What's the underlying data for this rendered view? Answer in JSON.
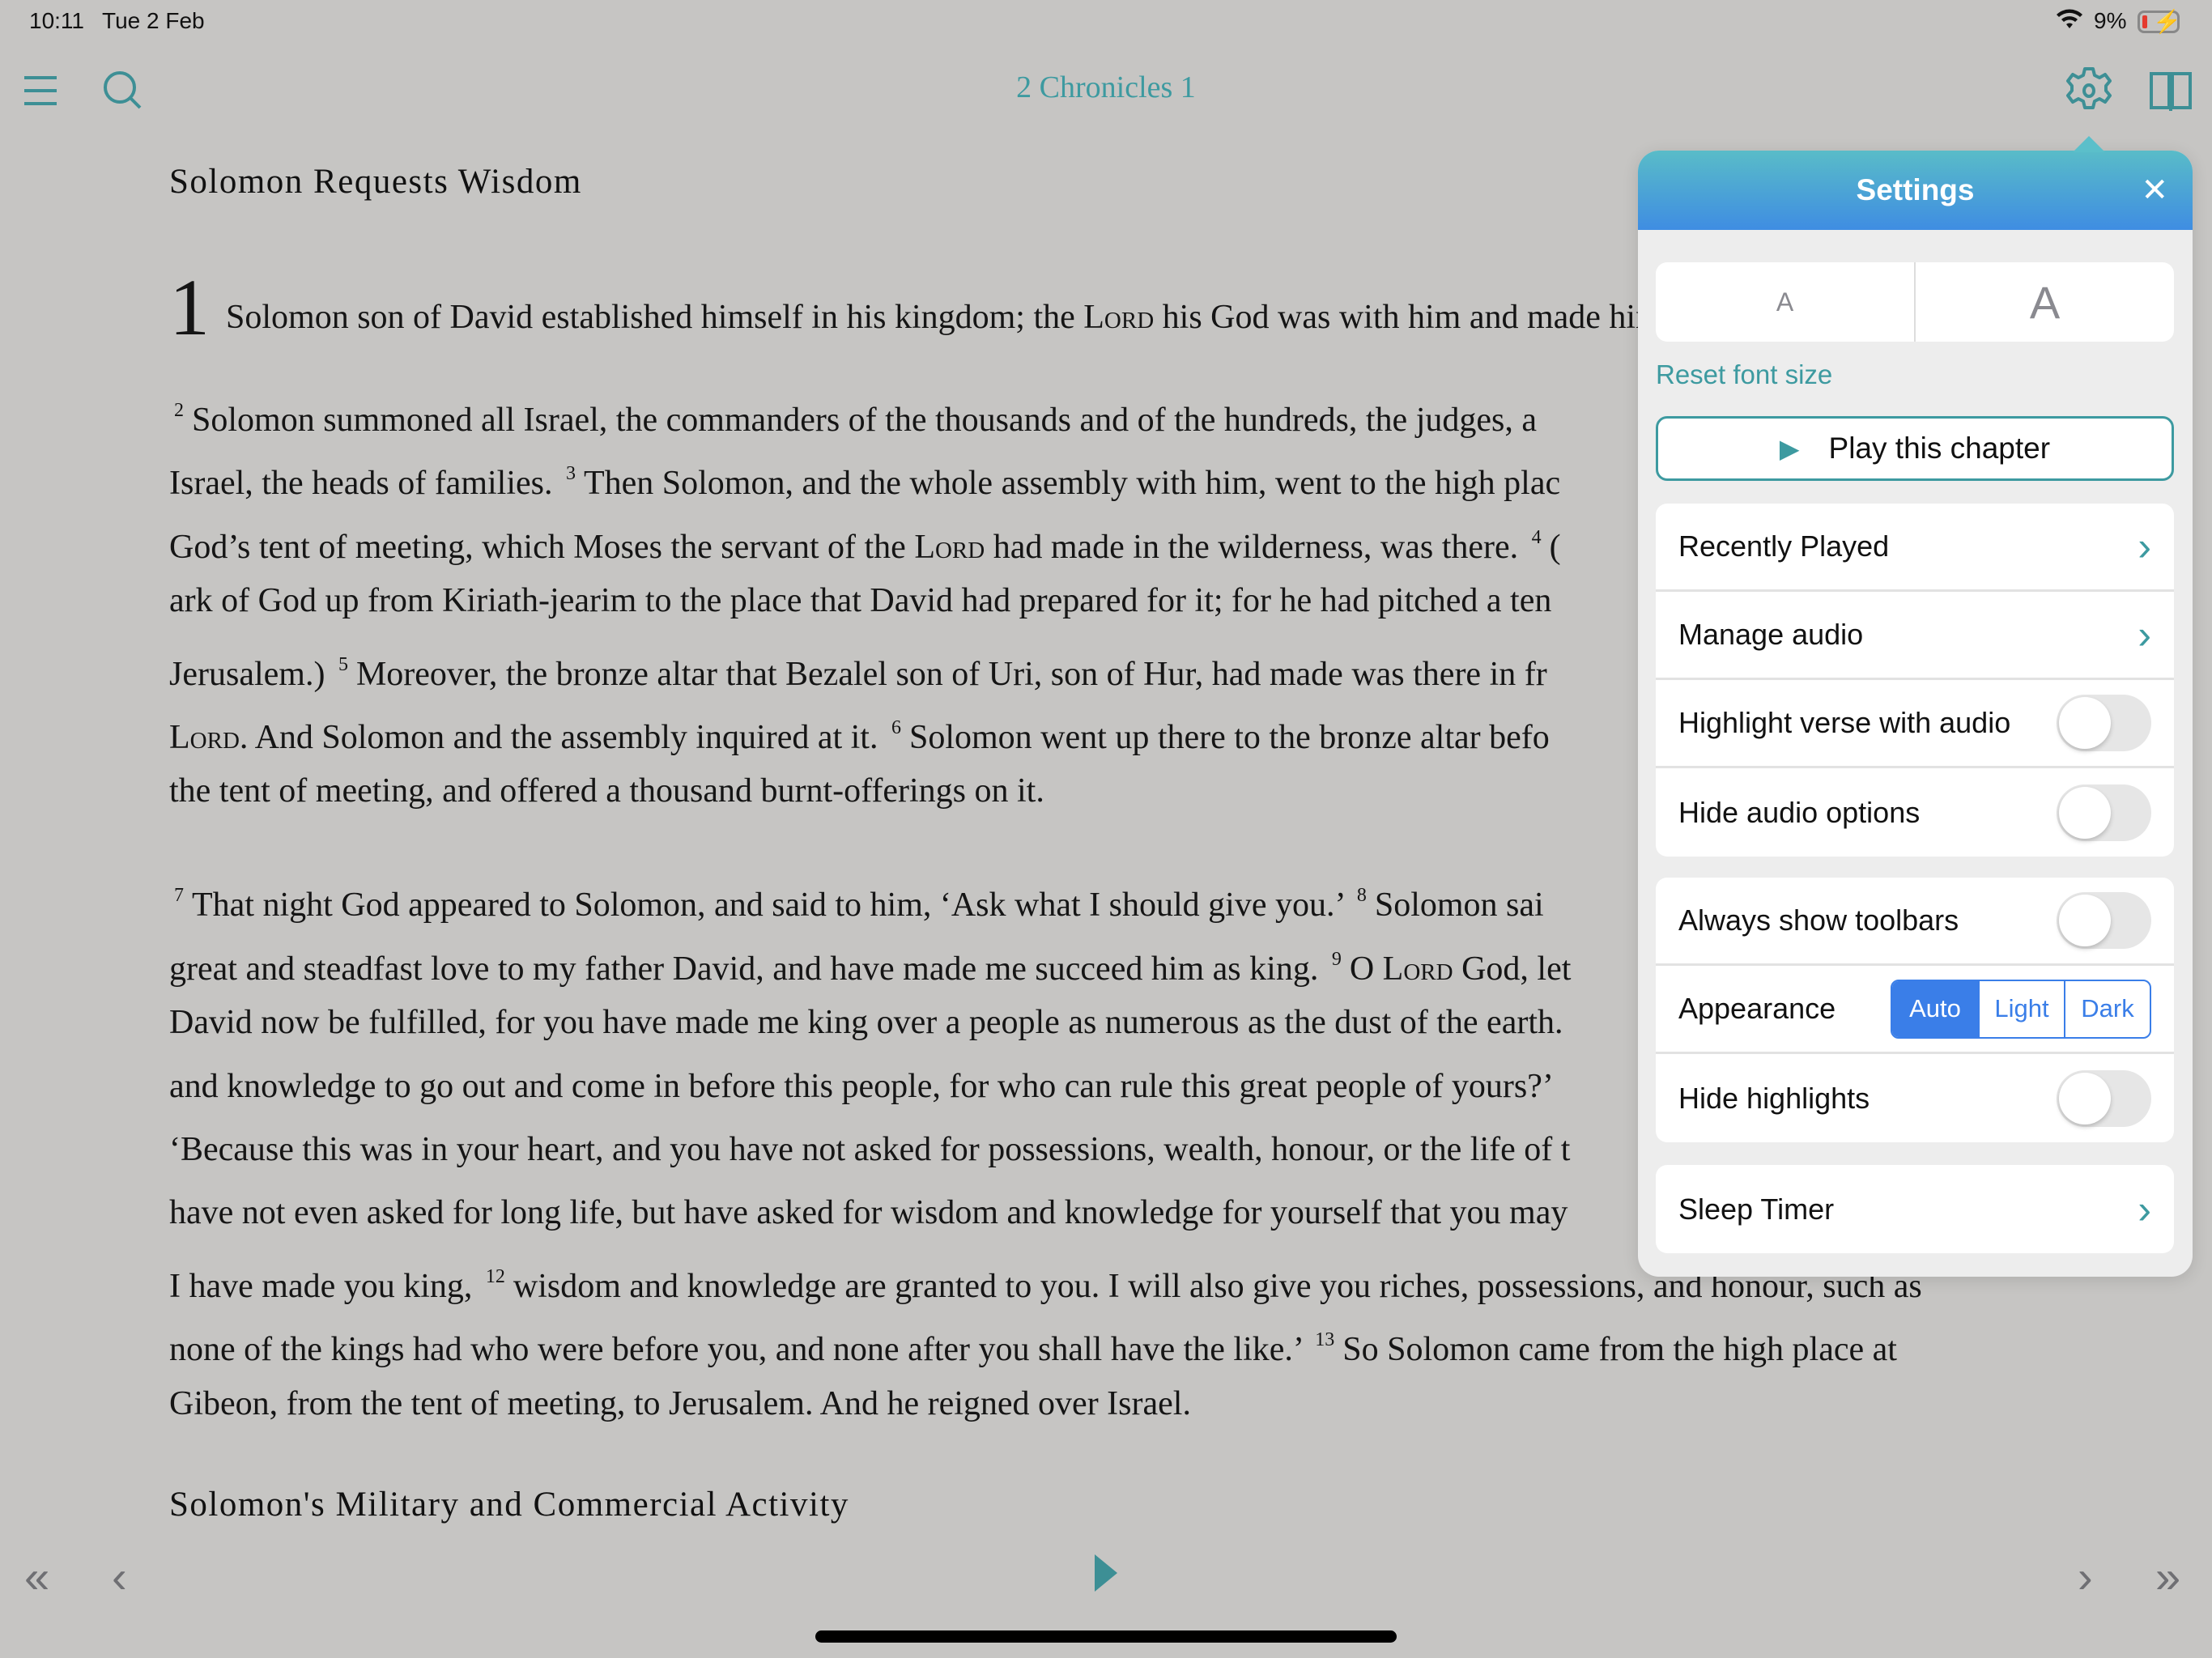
{
  "status": {
    "time": "10:11",
    "date": "Tue 2 Feb",
    "battery": "9%",
    "battery_level": 0.09
  },
  "header": {
    "title": "2 Chronicles 1",
    "icons": [
      "menu-icon",
      "search-icon",
      "gear-icon",
      "book-icon"
    ]
  },
  "colors": {
    "accent": "#3d9aa0",
    "segment": "#3a7ee8",
    "background": "#c6c5c3"
  },
  "reader": {
    "heading1": "Solomon Requests Wisdom",
    "heading2": "Solomon's Military and Commercial Activity",
    "lines": [
      [
        {
          "d": "1"
        },
        {
          "t": "Solomon son of David established himself in his kingdom; the "
        },
        {
          "s": "Lord"
        },
        {
          "t": " his God was with him and made him exceedingly great."
        }
      ],
      [
        {
          "v": "2"
        },
        {
          "t": "Solomon summoned all Israel, the commanders of the thousands and of the hundreds, the judges, a"
        }
      ],
      [
        {
          "t": "Israel, the heads of families. "
        },
        {
          "v": "3"
        },
        {
          "t": "Then Solomon, and the whole assembly with him, went to the high plac"
        }
      ],
      [
        {
          "t": "God’s tent of meeting, which Moses the servant of the "
        },
        {
          "s": "Lord"
        },
        {
          "t": " had made in the wilderness, was there. "
        },
        {
          "v": "4"
        },
        {
          "t": "("
        }
      ],
      [
        {
          "t": "ark of God up from Kiriath-jearim to the place that David had prepared for it; for he had pitched a ten"
        }
      ],
      [
        {
          "t": "Jerusalem.) "
        },
        {
          "v": "5"
        },
        {
          "t": "Moreover, the bronze altar that Bezalel son of Uri, son of Hur, had made was there in fr"
        }
      ],
      [
        {
          "s": "Lord"
        },
        {
          "t": ". And Solomon and the assembly inquired at it. "
        },
        {
          "v": "6"
        },
        {
          "t": "Solomon went up there to the bronze altar befo"
        }
      ],
      [
        {
          "t": "the tent of meeting, and offered a thousand burnt-offerings on it."
        }
      ],
      [
        {
          "v": "7"
        },
        {
          "t": "That night God appeared to Solomon, and said to him, ‘Ask what I should give you.’ "
        },
        {
          "v": "8"
        },
        {
          "t": "Solomon sai"
        }
      ],
      [
        {
          "t": "great and steadfast love to my father David, and have made me succeed him as king. "
        },
        {
          "v": "9"
        },
        {
          "t": "O "
        },
        {
          "s": "Lord"
        },
        {
          "t": " God, let"
        }
      ],
      [
        {
          "t": "David now be fulfilled, for you have made me king over a people as numerous as the dust of the earth."
        }
      ],
      [
        {
          "t": "and knowledge to go out and come in before this people, for who can rule this great people of yours?’"
        }
      ],
      [
        {
          "t": "‘Because this was in your heart, and you have not asked for possessions, wealth, honour, or the life of t"
        }
      ],
      [
        {
          "t": "have not even asked for long life, but have asked for wisdom and knowledge for yourself that you may"
        }
      ],
      [
        {
          "t": "I have made you king, "
        },
        {
          "v": "12"
        },
        {
          "t": "wisdom and knowledge are granted to you. I will also give you riches, possessions, and honour, such as"
        }
      ],
      [
        {
          "t": "none of the kings had who were before you, and none after you shall have the like.’ "
        },
        {
          "v": "13"
        },
        {
          "t": "So Solomon came from the high place at"
        }
      ],
      [
        {
          "t": "Gibeon, from the tent of meeting, to Jerusalem. And he reigned over Israel."
        }
      ]
    ]
  },
  "settings": {
    "title": "Settings",
    "font_small": "A",
    "font_large": "A",
    "reset_font": "Reset font size",
    "play": "Play this chapter",
    "recently_played": "Recently Played",
    "manage_audio": "Manage audio",
    "highlight_verse": "Highlight verse with audio",
    "highlight_verse_on": false,
    "hide_audio": "Hide audio options",
    "hide_audio_on": false,
    "always_toolbars": "Always show toolbars",
    "always_toolbars_on": false,
    "appearance": "Appearance",
    "appearance_options": [
      "Auto",
      "Light",
      "Dark"
    ],
    "appearance_selected": "Auto",
    "hide_highlights": "Hide highlights",
    "hide_highlights_on": false,
    "sleep_timer": "Sleep Timer"
  }
}
